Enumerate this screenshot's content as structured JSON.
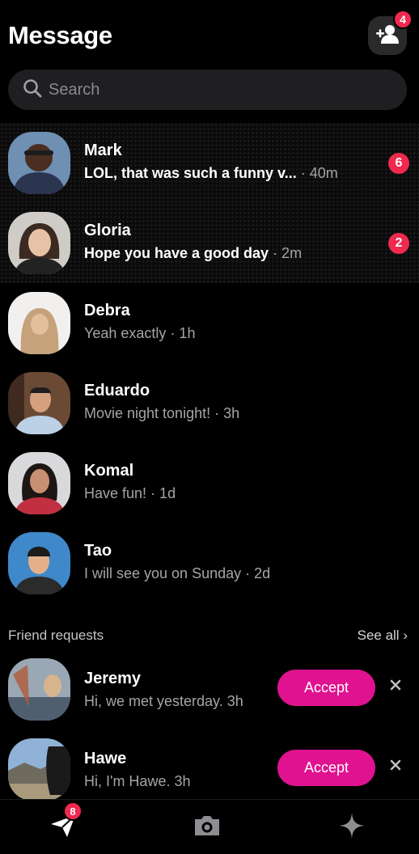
{
  "header": {
    "title": "Message",
    "add_friend_badge": "4"
  },
  "search": {
    "placeholder": "Search"
  },
  "conversations": [
    {
      "name": "Mark",
      "message": "LOL, that was such a funny v...",
      "time": "· 40m",
      "unread": "6"
    },
    {
      "name": "Gloria",
      "message": "Hope you have a good day",
      "time": "· 2m",
      "unread": "2"
    },
    {
      "name": "Debra",
      "message": "Yeah exactly",
      "time": "· 1h"
    },
    {
      "name": "Eduardo",
      "message": "Movie night tonight!",
      "time": "· 3h"
    },
    {
      "name": "Komal",
      "message": "Have fun!",
      "time": " · 1d"
    },
    {
      "name": "Tao",
      "message": "I will see you on Sunday",
      "time": "· 2d"
    }
  ],
  "friend_requests": {
    "title": "Friend requests",
    "see_all": "See all",
    "items": [
      {
        "name": "Jeremy",
        "message": "Hi, we met yesterday.",
        "time": "3h",
        "accept_label": "Accept"
      },
      {
        "name": "Hawe",
        "message": "Hi, I'm Hawe.",
        "time": "3h",
        "accept_label": "Accept"
      }
    ]
  },
  "bottom_nav": {
    "messages_badge": "8"
  },
  "colors": {
    "accent_pink": "#e0128f",
    "badge_red": "#f0294e",
    "background": "#000000"
  },
  "icons": [
    "add-friend-icon",
    "search-icon",
    "close-icon",
    "send-icon",
    "camera-icon",
    "sparkle-icon",
    "chevron-right-icon"
  ]
}
